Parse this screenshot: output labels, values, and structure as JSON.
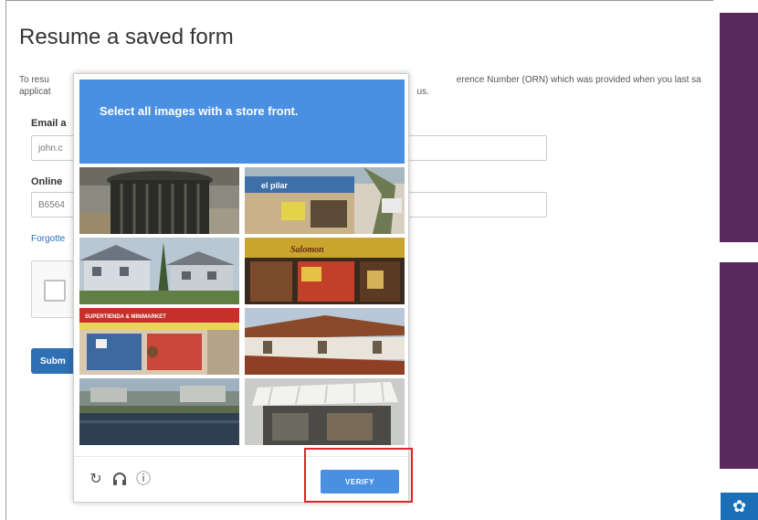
{
  "page": {
    "title": "Resume a saved form",
    "intro_line1": "To resu",
    "intro_line1_tail": "erence Number (ORN) which was provided when you last sa",
    "intro_line2": "applicat",
    "intro_line2_tail": "us."
  },
  "form": {
    "email_label": "Email a",
    "email_value": "john.c",
    "orn_label": "Online",
    "orn_value": "B6564",
    "forgot_link": "Forgotte",
    "submit_label": "Subm"
  },
  "captcha": {
    "prompt": "Select all images with a store front.",
    "verify_label": "VERIFY",
    "icons": [
      "reload-icon",
      "audio-icon",
      "info-icon"
    ],
    "tiles": [
      {
        "name": "tile-1",
        "subject": "trash-can"
      },
      {
        "name": "tile-2",
        "subject": "store-front-el-pilar"
      },
      {
        "name": "tile-3",
        "subject": "houses"
      },
      {
        "name": "tile-4",
        "subject": "store-front-sign"
      },
      {
        "name": "tile-5",
        "subject": "store-front-supertienda"
      },
      {
        "name": "tile-6",
        "subject": "tiled-roof"
      },
      {
        "name": "tile-7",
        "subject": "waterfront"
      },
      {
        "name": "tile-8",
        "subject": "awning-shop"
      }
    ]
  },
  "colors": {
    "captcha_blue": "#4a90e2",
    "side_purple": "#5a2a5c",
    "highlight_red": "#e0242b",
    "submit_blue": "#2f6fb4"
  }
}
